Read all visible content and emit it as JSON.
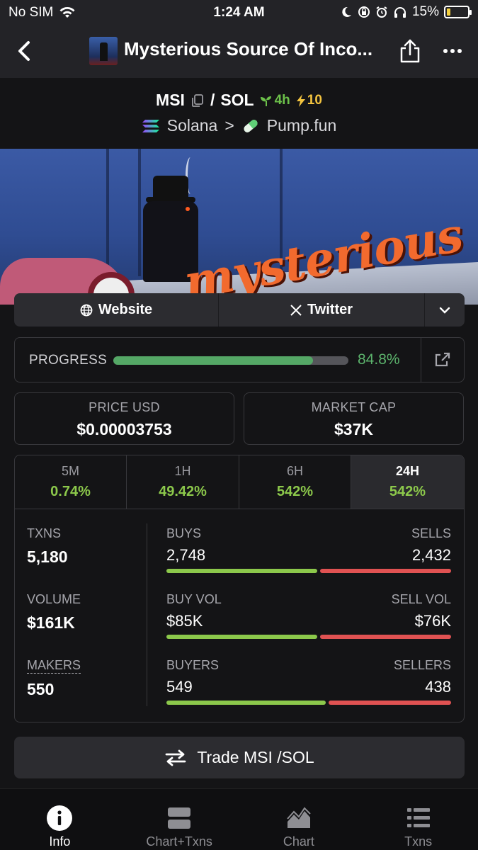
{
  "status_bar": {
    "carrier": "No SIM",
    "time": "1:24 AM",
    "battery": "15%"
  },
  "nav": {
    "title": "Mysterious Source Of Inco..."
  },
  "pair": {
    "base": "MSI",
    "separator": "/",
    "quote": "SOL",
    "age": "4h",
    "boosts": "10",
    "chain": "Solana",
    "chevron": ">",
    "dex": "Pump.fun"
  },
  "banner": {
    "text": "mysterious"
  },
  "links": {
    "website": "Website",
    "twitter": "Twitter"
  },
  "progress": {
    "label": "PROGRESS",
    "value_percent": 84.8,
    "value_text": "84.8%"
  },
  "stats": {
    "price_label": "PRICE USD",
    "price_value": "$0.00003753",
    "mcap_label": "MARKET CAP",
    "mcap_value": "$37K"
  },
  "timeframes": [
    {
      "label": "5M",
      "value": "0.74%"
    },
    {
      "label": "1H",
      "value": "49.42%"
    },
    {
      "label": "6H",
      "value": "542%"
    },
    {
      "label": "24H",
      "value": "542%"
    }
  ],
  "metrics": {
    "txns_label": "TXNS",
    "txns_value": "5,180",
    "buys_label": "BUYS",
    "buys_value": "2,748",
    "sells_label": "SELLS",
    "sells_value": "2,432",
    "buys_fraction": 0.53,
    "volume_label": "VOLUME",
    "volume_value": "$161K",
    "buyvol_label": "BUY VOL",
    "buyvol_value": "$85K",
    "sellvol_label": "SELL VOL",
    "sellvol_value": "$76K",
    "buyvol_fraction": 0.53,
    "makers_label": "MAKERS",
    "makers_value": "550",
    "buyers_label": "BUYERS",
    "buyers_value": "549",
    "sellers_label": "SELLERS",
    "sellers_value": "438",
    "buyers_fraction": 0.56
  },
  "trade": {
    "label": "Trade MSI /SOL"
  },
  "tab_bar": [
    {
      "label": "Info"
    },
    {
      "label": "Chart+Txns"
    },
    {
      "label": "Chart"
    },
    {
      "label": "Txns"
    }
  ],
  "colors": {
    "positive": "#8cc84b",
    "negative": "#e05252",
    "progress": "#55a866"
  }
}
